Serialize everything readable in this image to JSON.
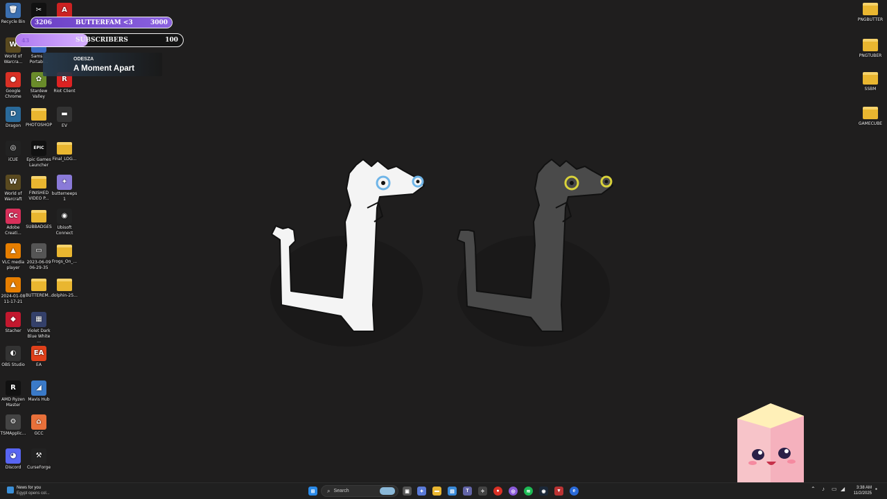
{
  "desktop_left": [
    {
      "id": "recycle-bin",
      "label": "Recycle Bin",
      "glyph": "🗑",
      "bg": "#3b6fb0"
    },
    {
      "id": "capcut",
      "label": "",
      "glyph": "✂",
      "bg": "#111"
    },
    {
      "id": "app-red",
      "label": "",
      "glyph": "A",
      "bg": "#c22"
    },
    {
      "id": "wow1",
      "label": "World of Warcra...",
      "glyph": "W",
      "bg": "#5a4a20"
    },
    {
      "id": "samsung",
      "label": "Sams... Portabl...",
      "glyph": "S",
      "bg": "#3b6ac1"
    },
    {
      "id": "chrome",
      "label": "Google Chrome",
      "glyph": "●",
      "bg": "#d93025"
    },
    {
      "id": "stardew",
      "label": "Stardew Valley",
      "glyph": "✿",
      "bg": "#6a8c2a"
    },
    {
      "id": "riot",
      "label": "Riot Client",
      "glyph": "R",
      "bg": "#d22"
    },
    {
      "id": "dragon",
      "label": "Dragon",
      "glyph": "D",
      "bg": "#2a6a9a"
    },
    {
      "id": "photoshop",
      "label": "PHOTOSHOP",
      "folder": true
    },
    {
      "id": "ev",
      "label": "EV",
      "glyph": "▬",
      "bg": "#333"
    },
    {
      "id": "icue",
      "label": "iCUE",
      "glyph": "◎",
      "bg": "#222"
    },
    {
      "id": "epic",
      "label": "Epic Games Launcher",
      "glyph": "EPIC",
      "bg": "#111"
    },
    {
      "id": "final-log",
      "label": "Final_LOG...",
      "folder": true
    },
    {
      "id": "wow2",
      "label": "World of Warcraft",
      "glyph": "W",
      "bg": "#5a4a20"
    },
    {
      "id": "finished-video",
      "label": "FINISHED VIDEO P...",
      "folder": true
    },
    {
      "id": "butterneeps",
      "label": "butterneeps 1",
      "glyph": "✦",
      "bg": "#8a7ad8"
    },
    {
      "id": "adobe-cc",
      "label": "Adobe Creati...",
      "glyph": "Cc",
      "bg": "#d8305a"
    },
    {
      "id": "subbadges",
      "label": "SUBBADGES",
      "folder": true
    },
    {
      "id": "ubisoft",
      "label": "Ubisoft Connect",
      "glyph": "◉",
      "bg": "#222"
    },
    {
      "id": "vlc",
      "label": "VLC media player",
      "glyph": "▲",
      "bg": "#e67e00"
    },
    {
      "id": "clip-2023",
      "label": "2023-06-09 06-29-35",
      "glyph": "▭",
      "bg": "#555"
    },
    {
      "id": "frogs",
      "label": "Frogs_On_...",
      "folder": true
    },
    {
      "id": "clip-2024",
      "label": "2024-01-08 11-17-21",
      "glyph": "▲",
      "bg": "#e67e00"
    },
    {
      "id": "butterem",
      "label": "BUTTEREM...",
      "folder": true
    },
    {
      "id": "dolphin",
      "label": "dolphin-25...",
      "folder": true
    },
    {
      "id": "stacher",
      "label": "Stacher",
      "glyph": "◆",
      "bg": "#c2182e"
    },
    {
      "id": "violet",
      "label": "Violet Dark Blue White ...",
      "glyph": "▦",
      "bg": "#34406a"
    },
    {
      "id": "obs",
      "label": "OBS Studio",
      "glyph": "◐",
      "bg": "#333"
    },
    {
      "id": "ea",
      "label": "EA",
      "glyph": "EA",
      "bg": "#e0401a"
    },
    {
      "id": "ryzen",
      "label": "AMD Ryzen Master",
      "glyph": "R",
      "bg": "#111"
    },
    {
      "id": "mavis",
      "label": "Mavis Hub",
      "glyph": "◢",
      "bg": "#3a7ac8"
    },
    {
      "id": "tsm",
      "label": "TSMApplic...",
      "glyph": "⚙",
      "bg": "#444"
    },
    {
      "id": "gcc",
      "label": "GCC",
      "glyph": "⌂",
      "bg": "#e8703a"
    },
    {
      "id": "discord",
      "label": "Discord",
      "glyph": "◕",
      "bg": "#5865f2"
    },
    {
      "id": "curseforge",
      "label": "CurseForge",
      "glyph": "⚒",
      "bg": "#222"
    }
  ],
  "desktop_right": [
    {
      "id": "pngbutter",
      "label": "PNGBUTTER"
    },
    {
      "id": "pngtuber",
      "label": "PNGTUBER"
    },
    {
      "id": "ssbm",
      "label": "SSBM"
    },
    {
      "id": "gamecube",
      "label": "GAMECUBE"
    }
  ],
  "overlay": {
    "goal1": {
      "current": "3206",
      "name": "BUTTERFAM <3",
      "target": "3000",
      "progress": 1.0
    },
    "goal2": {
      "current": "43",
      "name": "SUBSCRIBERS",
      "target": "100",
      "progress": 0.43
    },
    "now_playing": {
      "artist": "ODESZA",
      "title": "A Moment Apart"
    }
  },
  "taskbar": {
    "news_title": "News for you",
    "news_sub": "Egypt opens col...",
    "search_placeholder": "Search",
    "time": "3:38 AM",
    "date": "11/2/2025"
  },
  "colors": {
    "desktop_bg": "#1f1e1e",
    "goal_fill": "#7a4fd0",
    "sub_fill": "#c18cff"
  }
}
